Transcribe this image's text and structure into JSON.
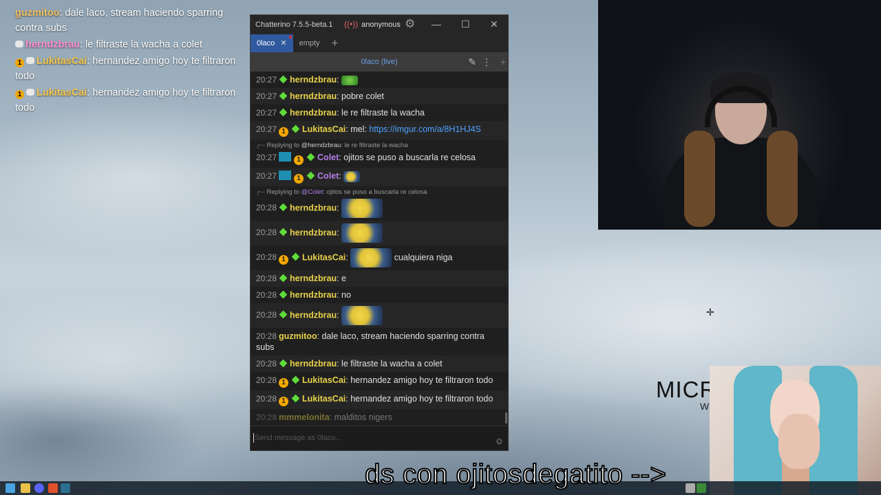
{
  "overlay_chat": [
    {
      "user": "guzmitoo",
      "text": ": dale laco, stream haciendo sparring contra subs",
      "color": "#f0c060",
      "badges": []
    },
    {
      "user": "herndzbrau",
      "text": ": le filtraste la wacha a colet",
      "color": "#ff8fd2",
      "badges": [
        "bubble"
      ]
    },
    {
      "user": "LukitasCai",
      "text": ": hernandez amigo hoy te filtraron todo",
      "color": "#f5c84c",
      "badges": [
        "sub",
        "bubble"
      ]
    },
    {
      "user": "LukitasCai",
      "text": ": hernandez amigo hoy te filtraron todo",
      "color": "#f5c84c",
      "badges": [
        "sub",
        "bubble"
      ]
    }
  ],
  "window": {
    "title": "Chatterino 7.5.5-beta.1",
    "account": "anonymous",
    "tabs": [
      {
        "label": "0laco",
        "active": true
      },
      {
        "label": "empty",
        "active": false
      }
    ],
    "channel_header": "0laco (live)",
    "input_placeholder": "Send message as 0laco..."
  },
  "messages": [
    {
      "time": "20:27",
      "user": "herndzbrau",
      "color": "#e8d24a",
      "badges": [
        "diamond"
      ],
      "text": "",
      "emote": "green"
    },
    {
      "time": "20:27",
      "user": "herndzbrau",
      "color": "#e8d24a",
      "badges": [
        "diamond"
      ],
      "text": "pobre colet"
    },
    {
      "time": "20:27",
      "user": "herndzbrau",
      "color": "#e8d24a",
      "badges": [
        "diamond"
      ],
      "text": "le re filtraste la wacha"
    },
    {
      "time": "20:27",
      "user": "LukitasCai",
      "color": "#e8d24a",
      "badges": [
        "sub",
        "diamond"
      ],
      "text": "mel: ",
      "link": "https://imgur.com/a/8H1HJ4S"
    },
    {
      "reply_to": "@herndzbrau",
      "reply_text": "le re filtraste la wacha"
    },
    {
      "time": "20:27",
      "user": "Colet",
      "color": "#b37fe8",
      "badges": [
        "blue",
        "sub",
        "diamond"
      ],
      "text": "ojitos se puso a buscarla re celosa"
    },
    {
      "time": "20:27",
      "user": "Colet",
      "color": "#b37fe8",
      "badges": [
        "blue",
        "sub",
        "diamond"
      ],
      "text": "",
      "emote": "small"
    },
    {
      "reply_to": "@Colet",
      "reply_text": "ojitos se puso a buscarla re celosa"
    },
    {
      "time": "20:28",
      "user": "herndzbrau",
      "color": "#e8d24a",
      "badges": [
        "diamond"
      ],
      "text": "",
      "emote": "big"
    },
    {
      "time": "20:28",
      "user": "herndzbrau",
      "color": "#e8d24a",
      "badges": [
        "diamond"
      ],
      "text": "",
      "emote": "big"
    },
    {
      "time": "20:28",
      "user": "LukitasCai",
      "color": "#e8d24a",
      "badges": [
        "sub",
        "diamond"
      ],
      "text": "cualquiera niga",
      "emote": "big"
    },
    {
      "time": "20:28",
      "user": "herndzbrau",
      "color": "#e8d24a",
      "badges": [
        "diamond"
      ],
      "text": "e"
    },
    {
      "time": "20:28",
      "user": "herndzbrau",
      "color": "#e8d24a",
      "badges": [
        "diamond"
      ],
      "text": "no"
    },
    {
      "time": "20:28",
      "user": "herndzbrau",
      "color": "#e8d24a",
      "badges": [
        "diamond"
      ],
      "text": "",
      "emote": "big"
    },
    {
      "time": "20:28",
      "user": "guzmitoo",
      "color": "#e8d24a",
      "badges": [],
      "text": "dale laco, stream haciendo sparring contra subs"
    },
    {
      "time": "20:28",
      "user": "herndzbrau",
      "color": "#e8d24a",
      "badges": [
        "diamond"
      ],
      "text": "le filtraste la wacha a colet"
    },
    {
      "time": "20:28",
      "user": "LukitasCai",
      "color": "#e8d24a",
      "badges": [
        "sub",
        "diamond"
      ],
      "text": "hernandez amigo hoy te filtraron todo"
    },
    {
      "time": "20:28",
      "user": "LukitasCai",
      "color": "#e8d24a",
      "badges": [
        "sub",
        "diamond"
      ],
      "text": "hernandez amigo hoy te filtraron todo"
    },
    {
      "time": "20:28",
      "user": "mmmelonita",
      "color": "#e8d24a",
      "badges": [],
      "text": "malditos nigers",
      "faded": true
    }
  ],
  "stream_overlay": {
    "caption": "ds con ojitosdegatito -->",
    "logo_text": "MICR",
    "logo_sub": "W"
  },
  "colors": {
    "window_bg": "#1f1f1f",
    "accent_tab": "#2f5aa0",
    "username": "#e8d24a",
    "link": "#4ea1ff"
  }
}
